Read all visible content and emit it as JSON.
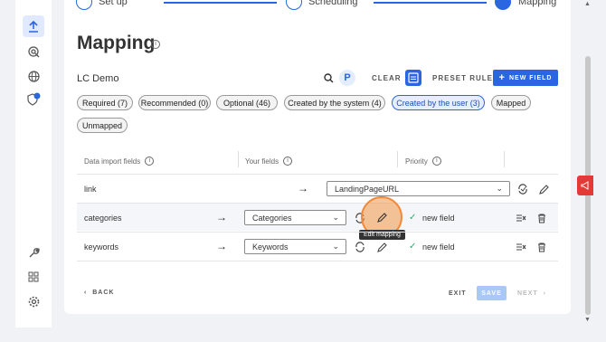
{
  "stepper": {
    "steps": [
      {
        "label": "Set up"
      },
      {
        "label": "Scheduling"
      },
      {
        "number": "3",
        "label": "Mapping"
      }
    ]
  },
  "page": {
    "title": "Mapping"
  },
  "toolbar": {
    "name": "LC Demo",
    "clear_label": "CLEAR",
    "preset_label": "PRESET RULES",
    "new_field_label": "NEW FIELD"
  },
  "filters": [
    {
      "label": "Required (7)"
    },
    {
      "label": "Recommended (0)"
    },
    {
      "label": "Optional (46)"
    },
    {
      "label": "Created by the system (4)"
    },
    {
      "label": "Created by the user (3)",
      "selected": true
    },
    {
      "label": "Mapped"
    },
    {
      "label": "Unmapped"
    }
  ],
  "table": {
    "headers": {
      "import_fields": "Data import fields",
      "your_fields": "Your fields",
      "priority": "Priority"
    },
    "rows": [
      {
        "import_field": "link",
        "your_field": "LandingPageURL",
        "priority": ""
      },
      {
        "import_field": "categories",
        "your_field": "Categories",
        "priority": "new field"
      },
      {
        "import_field": "keywords",
        "your_field": "Keywords",
        "priority": "new field"
      }
    ]
  },
  "tooltip": {
    "text": "Edit mapping"
  },
  "footer": {
    "back_label": "BACK",
    "exit_label": "EXIT",
    "save_label": "SAVE",
    "next_label": "NEXT"
  },
  "colors": {
    "accent": "#2a66e0",
    "highlight": "#f08a3c",
    "success": "#2bae66",
    "feedback": "#e53935"
  },
  "icons": {
    "rail": [
      "upload-icon",
      "target-icon",
      "globe-icon",
      "shield-badge-icon",
      "wrench-icon",
      "grid-icon",
      "settings-icon"
    ]
  }
}
